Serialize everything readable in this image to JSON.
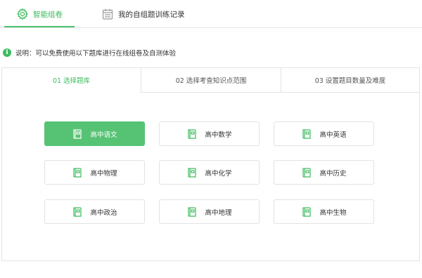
{
  "top_tabs": [
    {
      "label": "智能组卷",
      "icon": "gear-icon",
      "active": true
    },
    {
      "label": "我的自组题训练记录",
      "icon": "calendar-icon",
      "active": false
    }
  ],
  "info": {
    "icon": "info-icon",
    "icon_glyph": "i",
    "text": "说明：可以免费使用以下题库进行在线组卷及自测体验"
  },
  "steps": [
    {
      "label": "01 选择题库",
      "active": true
    },
    {
      "label": "02 选择考查知识点范围",
      "active": false
    },
    {
      "label": "03 设置题目数量及难度",
      "active": false
    }
  ],
  "subjects": [
    {
      "label": "高中语文",
      "active": true
    },
    {
      "label": "高中数学",
      "active": false
    },
    {
      "label": "高中英语",
      "active": false
    },
    {
      "label": "高中物理",
      "active": false
    },
    {
      "label": "高中化学",
      "active": false
    },
    {
      "label": "高中历史",
      "active": false
    },
    {
      "label": "高中政治",
      "active": false
    },
    {
      "label": "高中地理",
      "active": false
    },
    {
      "label": "高中生物",
      "active": false
    }
  ],
  "colors": {
    "accent": "#3dbb5f",
    "active_button": "#56c374",
    "border": "#e3e3e3"
  }
}
